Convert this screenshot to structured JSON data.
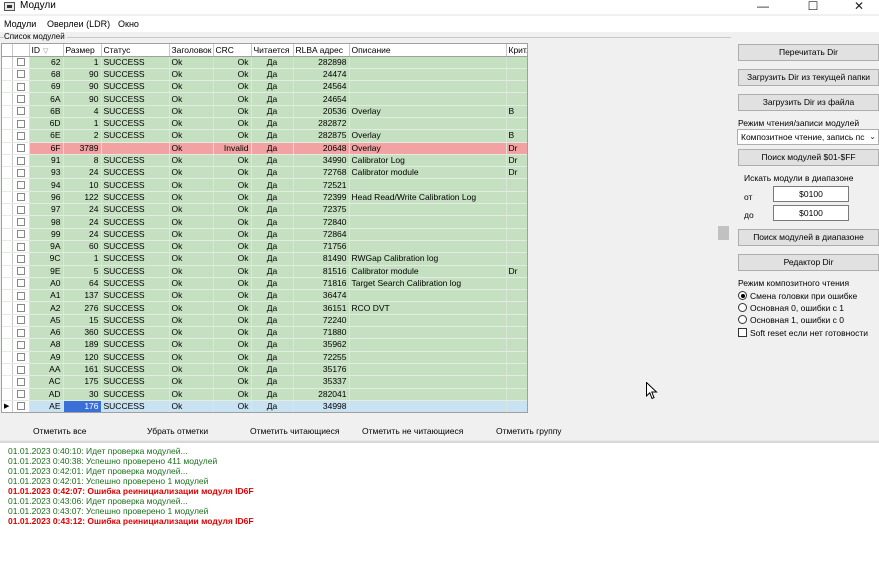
{
  "window": {
    "title": "Модули",
    "controls": [
      "—",
      "☐",
      "✕"
    ]
  },
  "menu": [
    "Модули",
    "Оверлеи (LDR)",
    "Окно"
  ],
  "group_title": "Список модулей",
  "table": {
    "columns": [
      "ID",
      "Размер",
      "Статус",
      "Заголовок",
      "CRC",
      "Читается",
      "RLBA адрес",
      "Описание",
      "Крит."
    ],
    "rows": [
      {
        "id": "62",
        "size": "1",
        "status": "SUCCESS",
        "header": "Ok",
        "crc": "Ok",
        "readable": "Да",
        "rlba": "282898",
        "desc": "",
        "crit": "",
        "state": "ok"
      },
      {
        "id": "68",
        "size": "90",
        "status": "SUCCESS",
        "header": "Ok",
        "crc": "Ok",
        "readable": "Да",
        "rlba": "24474",
        "desc": "",
        "crit": "",
        "state": "ok"
      },
      {
        "id": "69",
        "size": "90",
        "status": "SUCCESS",
        "header": "Ok",
        "crc": "Ok",
        "readable": "Да",
        "rlba": "24564",
        "desc": "",
        "crit": "",
        "state": "ok"
      },
      {
        "id": "6A",
        "size": "90",
        "status": "SUCCESS",
        "header": "Ok",
        "crc": "Ok",
        "readable": "Да",
        "rlba": "24654",
        "desc": "",
        "crit": "",
        "state": "ok"
      },
      {
        "id": "6B",
        "size": "4",
        "status": "SUCCESS",
        "header": "Ok",
        "crc": "Ok",
        "readable": "Да",
        "rlba": "20536",
        "desc": "Overlay",
        "crit": "B",
        "state": "ok"
      },
      {
        "id": "6D",
        "size": "1",
        "status": "SUCCESS",
        "header": "Ok",
        "crc": "Ok",
        "readable": "Да",
        "rlba": "282872",
        "desc": "",
        "crit": "",
        "state": "ok"
      },
      {
        "id": "6E",
        "size": "2",
        "status": "SUCCESS",
        "header": "Ok",
        "crc": "Ok",
        "readable": "Да",
        "rlba": "282875",
        "desc": "Overlay",
        "crit": "B",
        "state": "ok"
      },
      {
        "id": "6F",
        "size": "3789",
        "status": "",
        "header": "Ok",
        "crc": "Invalid",
        "readable": "Да",
        "rlba": "20648",
        "desc": "Overlay",
        "crit": "Dr",
        "state": "bad"
      },
      {
        "id": "91",
        "size": "8",
        "status": "SUCCESS",
        "header": "Ok",
        "crc": "Ok",
        "readable": "Да",
        "rlba": "34990",
        "desc": "Calibrator Log",
        "crit": "Dr",
        "state": "ok"
      },
      {
        "id": "93",
        "size": "24",
        "status": "SUCCESS",
        "header": "Ok",
        "crc": "Ok",
        "readable": "Да",
        "rlba": "72768",
        "desc": "Calibrator module",
        "crit": "Dr",
        "state": "ok"
      },
      {
        "id": "94",
        "size": "10",
        "status": "SUCCESS",
        "header": "Ok",
        "crc": "Ok",
        "readable": "Да",
        "rlba": "72521",
        "desc": "",
        "crit": "",
        "state": "ok"
      },
      {
        "id": "96",
        "size": "122",
        "status": "SUCCESS",
        "header": "Ok",
        "crc": "Ok",
        "readable": "Да",
        "rlba": "72399",
        "desc": "Head Read/Write Calibration Log",
        "crit": "",
        "state": "ok"
      },
      {
        "id": "97",
        "size": "24",
        "status": "SUCCESS",
        "header": "Ok",
        "crc": "Ok",
        "readable": "Да",
        "rlba": "72375",
        "desc": "",
        "crit": "",
        "state": "ok"
      },
      {
        "id": "98",
        "size": "24",
        "status": "SUCCESS",
        "header": "Ok",
        "crc": "Ok",
        "readable": "Да",
        "rlba": "72840",
        "desc": "",
        "crit": "",
        "state": "ok"
      },
      {
        "id": "99",
        "size": "24",
        "status": "SUCCESS",
        "header": "Ok",
        "crc": "Ok",
        "readable": "Да",
        "rlba": "72864",
        "desc": "",
        "crit": "",
        "state": "ok"
      },
      {
        "id": "9A",
        "size": "60",
        "status": "SUCCESS",
        "header": "Ok",
        "crc": "Ok",
        "readable": "Да",
        "rlba": "71756",
        "desc": "",
        "crit": "",
        "state": "ok"
      },
      {
        "id": "9C",
        "size": "1",
        "status": "SUCCESS",
        "header": "Ok",
        "crc": "Ok",
        "readable": "Да",
        "rlba": "81490",
        "desc": "RWGap Calibration log",
        "crit": "",
        "state": "ok"
      },
      {
        "id": "9E",
        "size": "5",
        "status": "SUCCESS",
        "header": "Ok",
        "crc": "Ok",
        "readable": "Да",
        "rlba": "81516",
        "desc": "Calibrator module",
        "crit": "Dr",
        "state": "ok"
      },
      {
        "id": "A0",
        "size": "64",
        "status": "SUCCESS",
        "header": "Ok",
        "crc": "Ok",
        "readable": "Да",
        "rlba": "71816",
        "desc": "Target Search Calibration log",
        "crit": "",
        "state": "ok"
      },
      {
        "id": "A1",
        "size": "137",
        "status": "SUCCESS",
        "header": "Ok",
        "crc": "Ok",
        "readable": "Да",
        "rlba": "36474",
        "desc": "",
        "crit": "",
        "state": "ok"
      },
      {
        "id": "A2",
        "size": "276",
        "status": "SUCCESS",
        "header": "Ok",
        "crc": "Ok",
        "readable": "Да",
        "rlba": "36151",
        "desc": "RCO DVT",
        "crit": "",
        "state": "ok"
      },
      {
        "id": "A5",
        "size": "15",
        "status": "SUCCESS",
        "header": "Ok",
        "crc": "Ok",
        "readable": "Да",
        "rlba": "72240",
        "desc": "",
        "crit": "",
        "state": "ok"
      },
      {
        "id": "A6",
        "size": "360",
        "status": "SUCCESS",
        "header": "Ok",
        "crc": "Ok",
        "readable": "Да",
        "rlba": "71880",
        "desc": "",
        "crit": "",
        "state": "ok"
      },
      {
        "id": "A8",
        "size": "189",
        "status": "SUCCESS",
        "header": "Ok",
        "crc": "Ok",
        "readable": "Да",
        "rlba": "35962",
        "desc": "",
        "crit": "",
        "state": "ok"
      },
      {
        "id": "A9",
        "size": "120",
        "status": "SUCCESS",
        "header": "Ok",
        "crc": "Ok",
        "readable": "Да",
        "rlba": "72255",
        "desc": "",
        "crit": "",
        "state": "ok"
      },
      {
        "id": "AA",
        "size": "161",
        "status": "SUCCESS",
        "header": "Ok",
        "crc": "Ok",
        "readable": "Да",
        "rlba": "35176",
        "desc": "",
        "crit": "",
        "state": "ok"
      },
      {
        "id": "AC",
        "size": "175",
        "status": "SUCCESS",
        "header": "Ok",
        "crc": "Ok",
        "readable": "Да",
        "rlba": "35337",
        "desc": "",
        "crit": "",
        "state": "ok"
      },
      {
        "id": "AD",
        "size": "30",
        "status": "SUCCESS",
        "header": "Ok",
        "crc": "Ok",
        "readable": "Да",
        "rlba": "282041",
        "desc": "",
        "crit": "",
        "state": "ok"
      },
      {
        "id": "AE",
        "size": "176",
        "status": "SUCCESS",
        "header": "Ok",
        "crc": "Ok",
        "readable": "Да",
        "rlba": "34998",
        "desc": "",
        "crit": "",
        "state": "sel",
        "current": true
      }
    ]
  },
  "right_panel": {
    "reread_dir": "Перечитать Dir",
    "load_dir_folder": "Загрузить Dir из текущей папки",
    "load_dir_file": "Загрузить Dir из файла",
    "rw_mode_label": "Режим чтения/записи модулей",
    "rw_mode_value": "Композитное чтение, запись пс",
    "search_01_ff": "Поиск модулей $01-$FF",
    "search_range_label": "Искать модули в диапазоне",
    "from_label": "от",
    "from_value": "$0100",
    "to_label": "до",
    "to_value": "$0100",
    "search_range_button": "Поиск модулей в диапазоне",
    "dir_editor": "Редактор Dir",
    "composite_mode_label": "Режим композитного чтения",
    "options": [
      {
        "label": "Смена головки при ошибке",
        "type": "radio",
        "checked": true
      },
      {
        "label": "Основная 0, ошибки с 1",
        "type": "radio",
        "checked": false
      },
      {
        "label": "Основная 1, ошибки с 0",
        "type": "radio",
        "checked": false
      },
      {
        "label": "Soft reset если нет готовности",
        "type": "checkbox",
        "checked": false
      }
    ]
  },
  "bottom_buttons": [
    "Отметить все",
    "Убрать отметки",
    "Отметить читающиеся",
    "Отметить не читающиеся",
    "Отметить группу"
  ],
  "log": [
    {
      "text": "01.01.2023 0:40:10: Идет проверка модулей...",
      "error": false
    },
    {
      "text": "01.01.2023 0:40:38: Успешно проверено 411 модулей",
      "error": false
    },
    {
      "text": "01.01.2023 0:42:01: Идет проверка модулей...",
      "error": false
    },
    {
      "text": "01.01.2023 0:42:01: Успешно проверено 1 модулей",
      "error": false
    },
    {
      "text": "01.01.2023 0:42:07: Ошибка реинициализации модуля ID6F",
      "error": true
    },
    {
      "text": "01.01.2023 0:43:06: Идет проверка модулей...",
      "error": false
    },
    {
      "text": "01.01.2023 0:43:07: Успешно проверено 1 модулей",
      "error": false
    },
    {
      "text": "01.01.2023 0:43:12: Ошибка реинициализации модуля ID6F",
      "error": true
    }
  ],
  "colors": {
    "row_ok": "#c5e0c0",
    "row_bad": "#f2a2a2",
    "row_selected": "#c8e2f2",
    "log_info": "#1c6e1c",
    "log_error": "#e00000"
  }
}
